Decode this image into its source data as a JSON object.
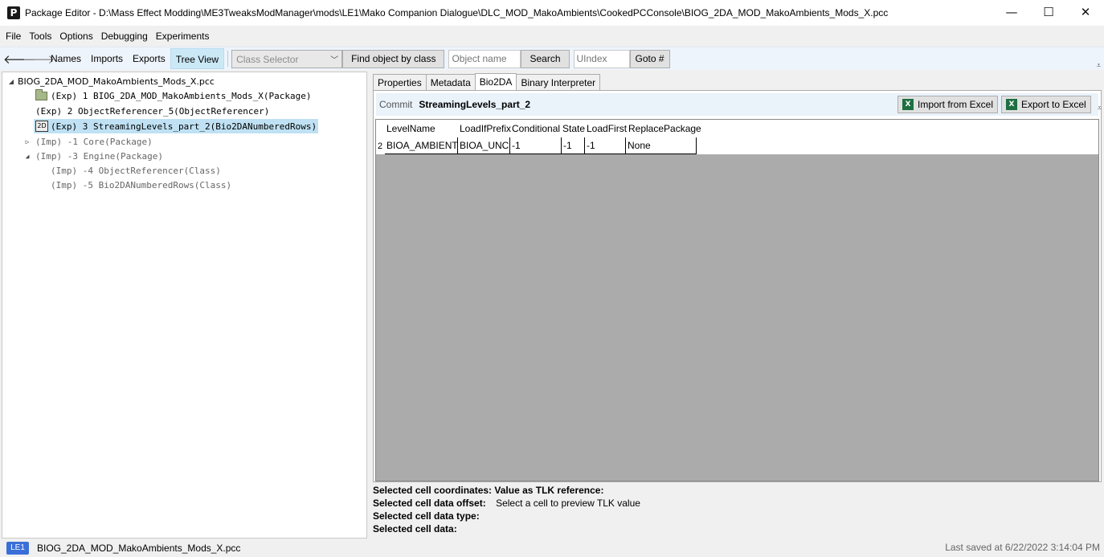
{
  "window": {
    "app_icon": "P",
    "title": "Package Editor - D:\\Mass Effect Modding\\ME3TweaksModManager\\mods\\LE1\\Mako Companion Dialogue\\DLC_MOD_MakoAmbients\\CookedPCConsole\\BIOG_2DA_MOD_MakoAmbients_Mods_X.pcc",
    "minimize": "—",
    "maximize": "☐",
    "close": "✕"
  },
  "menu": [
    "File",
    "Tools",
    "Options",
    "Debugging",
    "Experiments"
  ],
  "toolbar": {
    "back": "🡐",
    "forward": "🡒",
    "names": "Names",
    "imports": "Imports",
    "exports": "Exports",
    "tree_view": "Tree View",
    "class_selector": "Class Selector",
    "find_by_class": "Find object by class",
    "object_name_placeholder": "Object name",
    "search": "Search",
    "uindex_placeholder": "UIndex",
    "goto": "Goto #",
    "overflow": "⩡"
  },
  "tree": {
    "root": "BIOG_2DA_MOD_MakoAmbients_Mods_X.pcc",
    "items": [
      {
        "label": "(Exp) 1 BIOG_2DA_MOD_MakoAmbients_Mods_X(Package)",
        "icon": "folder-icon"
      },
      {
        "label": "(Exp) 2 ObjectReferencer_5(ObjectReferencer)"
      },
      {
        "label": "(Exp) 3 StreamingLevels_part_2(Bio2DANumberedRows)",
        "icon": "bio2da-icon",
        "icon_text": "2D",
        "selected": true
      },
      {
        "label": "(Imp) -1 Core(Package)",
        "expander": "▷"
      },
      {
        "label": "(Imp) -3 Engine(Package)",
        "expander": "◢"
      },
      {
        "label": "(Imp) -4 ObjectReferencer(Class)"
      },
      {
        "label": "(Imp) -5 Bio2DANumberedRows(Class)"
      }
    ]
  },
  "tabs": [
    "Properties",
    "Metadata",
    "Bio2DA",
    "Binary Interpreter"
  ],
  "bio2da": {
    "commit_label": "Commit",
    "table_name": "StreamingLevels_part_2",
    "import_excel": "Import from Excel",
    "export_excel": "Export to Excel",
    "excel_icon": "X",
    "columns": [
      "LevelName",
      "LoadIfPrefix",
      "Conditional",
      "State",
      "LoadFirst",
      "ReplacePackage"
    ],
    "rows": [
      {
        "header": "2",
        "cells": [
          "BIOA_AMBIENTS",
          "BIOA_UNC",
          "-1",
          "-1",
          "-1",
          "None"
        ]
      }
    ]
  },
  "info": {
    "coords_label": "Selected cell coordinates:",
    "tlk_label": "Value as TLK reference:",
    "offset_label": "Selected cell data offset:",
    "tlk_preview": "Select a cell to preview TLK value",
    "type_label": "Selected cell data type:",
    "data_label": "Selected cell data:"
  },
  "status": {
    "game": "LE1",
    "file": "BIOG_2DA_MOD_MakoAmbients_Mods_X.pcc",
    "saved": "Last saved at 6/22/2022 3:14:04 PM"
  },
  "colors": {
    "accent_selected": "#bfe1f3",
    "game_badge": "#3a6fd8",
    "excel_green": "#1d6f42"
  }
}
